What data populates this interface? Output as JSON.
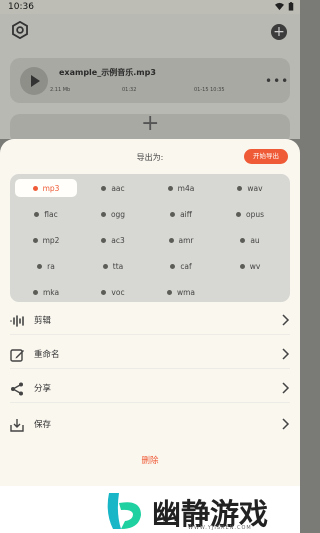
{
  "status_bar": {
    "time": "10:36"
  },
  "background": {
    "file_card": {
      "file_name": "example_示例音乐.mp3",
      "size": "2.11 Mb",
      "duration": "01:32",
      "date": "01-15 10:35"
    }
  },
  "sheet": {
    "title": "导出为:",
    "start_button": "开始导出",
    "selected_format": "mp3",
    "formats": [
      "mp3",
      "aac",
      "m4a",
      "wav",
      "flac",
      "ogg",
      "aiff",
      "opus",
      "mp2",
      "ac3",
      "amr",
      "au",
      "ra",
      "tta",
      "caf",
      "wv",
      "mka",
      "voc",
      "wma"
    ],
    "actions": [
      {
        "label": "剪辑",
        "icon": "waveform-icon"
      },
      {
        "label": "重命名",
        "icon": "edit-icon"
      },
      {
        "label": "分享",
        "icon": "share-icon"
      },
      {
        "label": "保存",
        "icon": "save-icon"
      }
    ],
    "delete_label": "删除"
  },
  "watermark": {
    "brand": "幽静游戏",
    "url": "WWW.YJISREN.COM"
  },
  "colors": {
    "accent": "#ef5b36",
    "sheet_bg": "#faf7ef",
    "format_bg": "#d7d7d3"
  }
}
